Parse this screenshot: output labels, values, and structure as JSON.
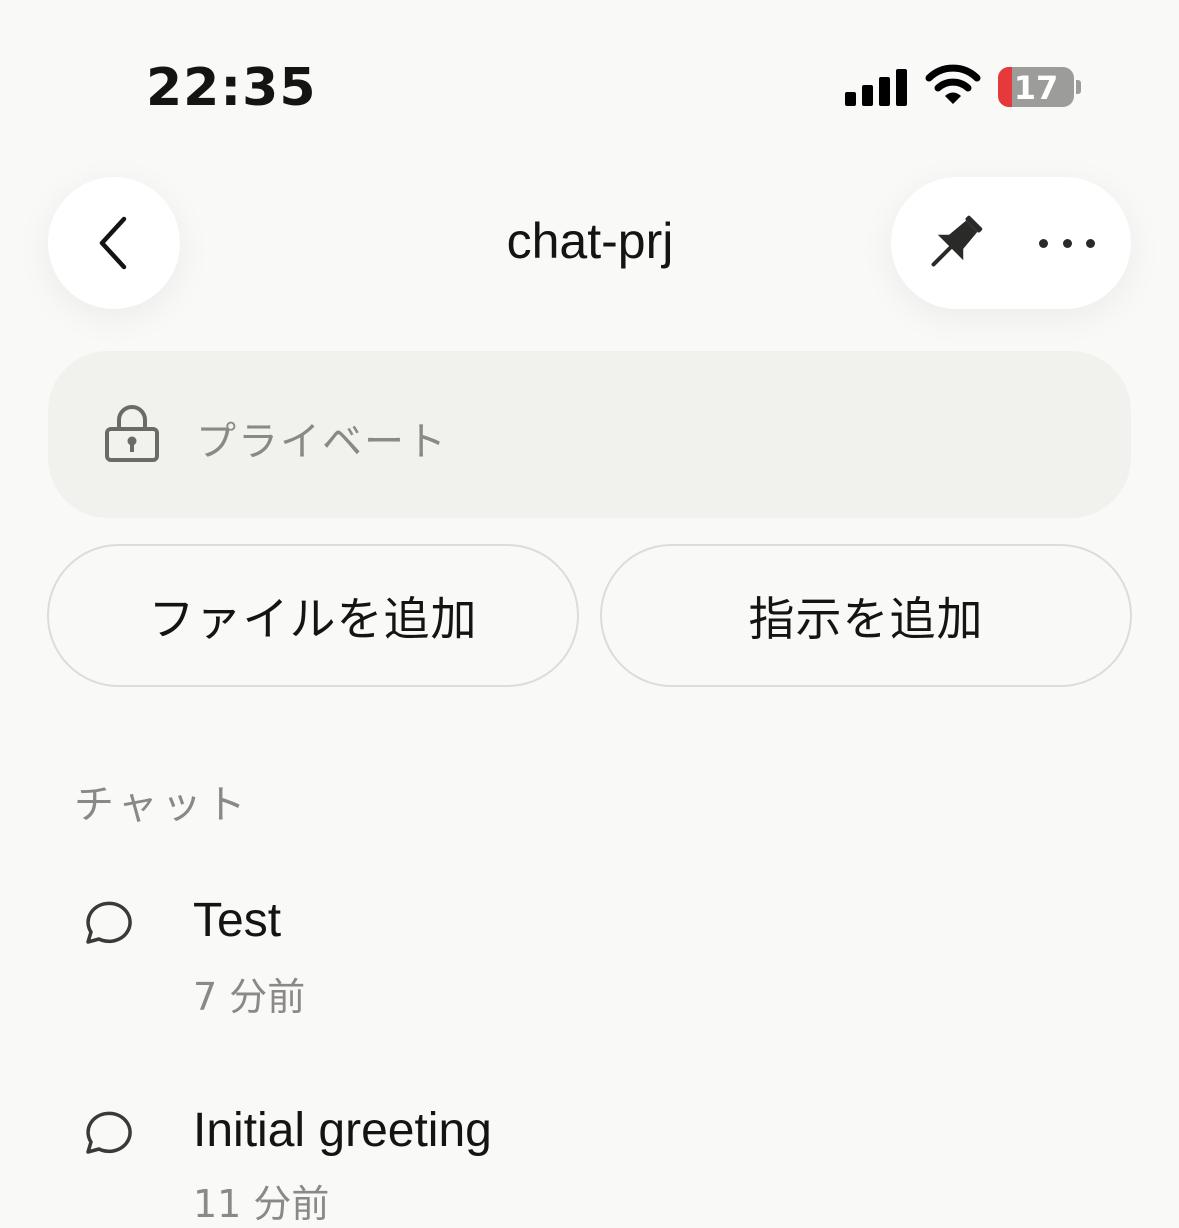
{
  "status_bar": {
    "time": "22:35",
    "battery": "17"
  },
  "header": {
    "title": "chat-prj"
  },
  "visibility": {
    "label": "プライベート"
  },
  "actions": {
    "add_file": "ファイルを追加",
    "add_instructions": "指示を追加"
  },
  "chats": {
    "section_label": "チャット",
    "items": [
      {
        "title": "Test",
        "time": "7 分前"
      },
      {
        "title": "Initial greeting",
        "time": "11 分前"
      }
    ]
  }
}
